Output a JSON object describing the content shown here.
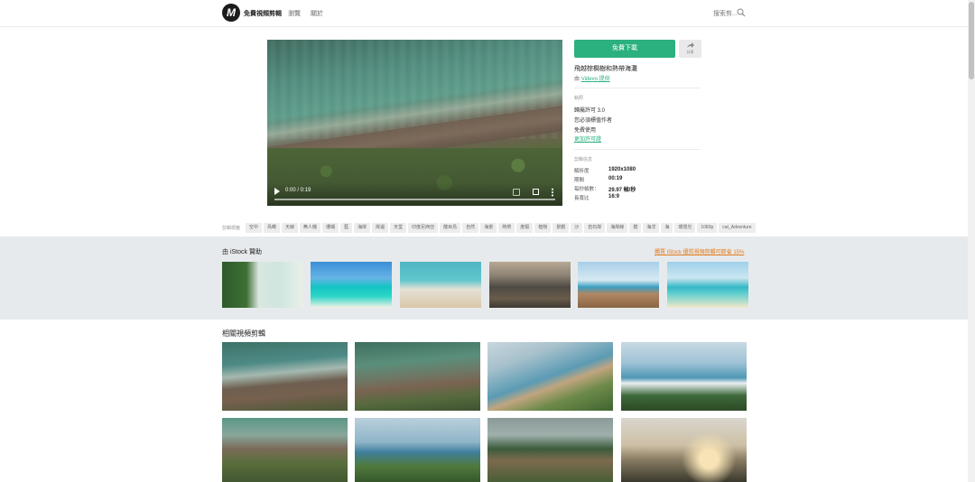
{
  "header": {
    "logo_mark": "M",
    "site_name": "免費視頻剪輯",
    "nav": [
      "瀏覽",
      "關於"
    ],
    "search_label": "搜索剪...",
    "search_icon": "search-icon"
  },
  "player": {
    "time": "0:00 / 0:19",
    "progress": 0.0
  },
  "actions": {
    "download_label": "免費下載",
    "share_label": "分享",
    "share_icon": "share-icon"
  },
  "clip": {
    "title": "飛越棕櫚樹和熱帶海灘",
    "provided_prefix": "由",
    "provider": "Videvo 提供"
  },
  "license": {
    "section_label": "執照",
    "lines": [
      "歸屬許可 3.0",
      "您必須標值作者",
      "免費使用"
    ],
    "more_link": "更加許可證"
  },
  "specs": {
    "section_label": "剪輯信息",
    "rows": [
      {
        "key": "解析度",
        "value": "1920x1080"
      },
      {
        "key": "期間",
        "value": "00:19"
      },
      {
        "key": "每秒幀數：",
        "value": "29.97 幀/秒"
      },
      {
        "key": "長寬比",
        "value": "16:9"
      }
    ]
  },
  "tags": {
    "label": "剪輯標籤",
    "items": [
      "空中",
      "鳥瞰",
      "天線",
      "無人機",
      "珊瑚",
      "藍",
      "海岸",
      "岸邊",
      "天堂",
      "印度尼西亞",
      "龍目島",
      "自然",
      "海景",
      "熱帶",
      "度假",
      "植物",
      "景觀",
      "沙",
      "岩石岸",
      "海岸線",
      "樹",
      "海洋",
      "海",
      "環境光",
      "1080p",
      "cat_Adventure"
    ]
  },
  "istock": {
    "title": "由 iStock 贊助",
    "promo": "獨賈 iStock 優質視頻剪輯可節省 15%"
  },
  "related": {
    "title": "相關視頻剪輯"
  },
  "colors": {
    "accent": "#2bb07f",
    "promo": "#e07b1c",
    "sponsor_bg": "#e7eaec"
  }
}
